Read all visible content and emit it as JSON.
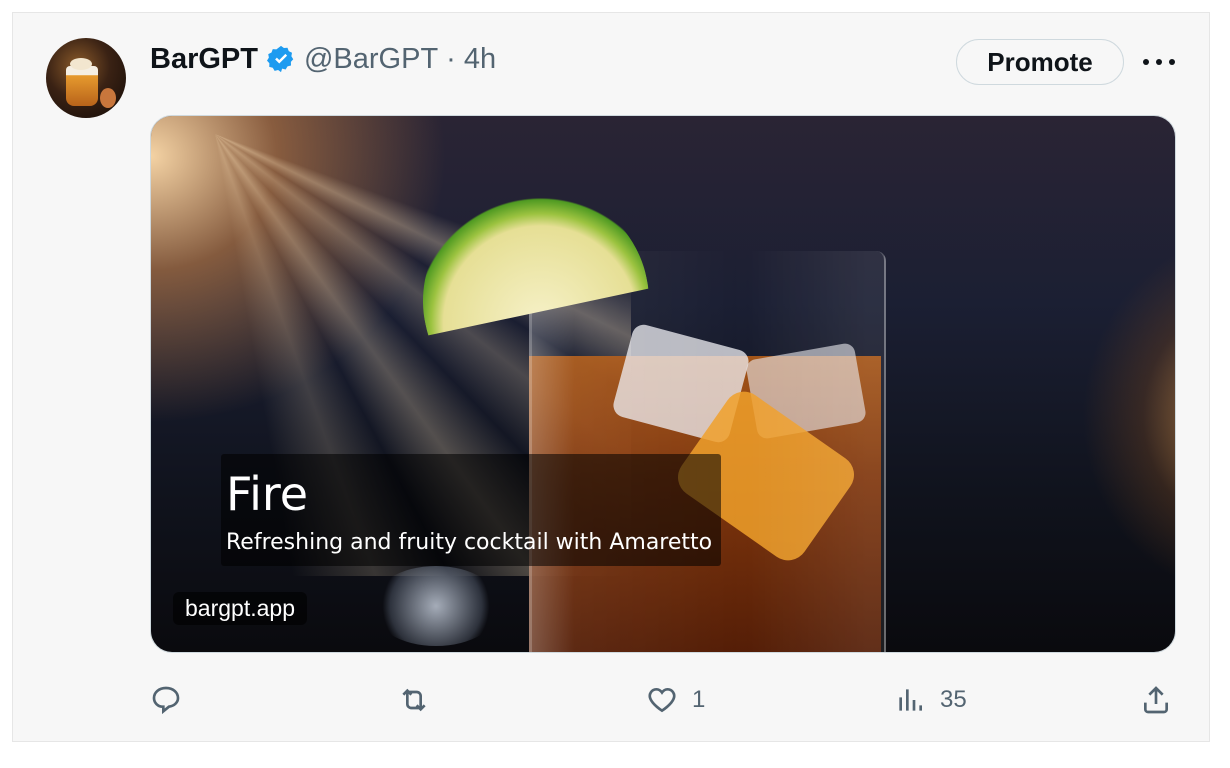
{
  "post": {
    "author_name": "BarGPT",
    "author_handle": "@BarGPT",
    "separator": "·",
    "time": "4h",
    "verified": true,
    "avatar_icon": "cocktail-avatar"
  },
  "header_actions": {
    "promote_label": "Promote",
    "more_icon": "more-horizontal-icon"
  },
  "card": {
    "title": "Fire",
    "description": "Refreshing and fruity cocktail with Amaretto",
    "domain": "bargpt.app",
    "image": "cocktail-with-lime-and-ice"
  },
  "actions": {
    "reply_icon": "reply-icon",
    "reply_count": "",
    "repost_icon": "repost-icon",
    "repost_count": "",
    "like_icon": "heart-icon",
    "like_count": "1",
    "views_icon": "views-icon",
    "views_count": "35",
    "share_icon": "share-icon"
  },
  "colors": {
    "verified_blue": "#1d9bf0",
    "text_primary": "#0f1419",
    "text_secondary": "#536471",
    "background": "#f7f7f7"
  }
}
